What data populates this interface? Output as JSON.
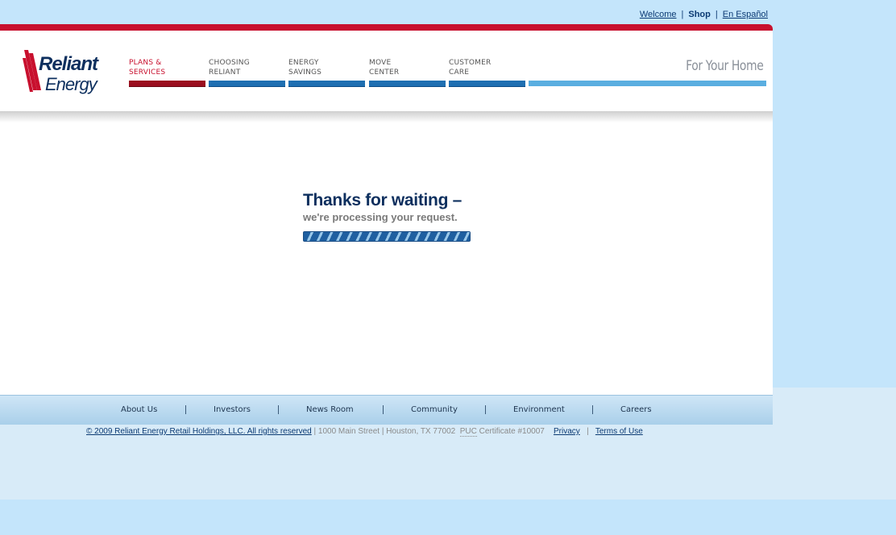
{
  "util": {
    "welcome": "Welcome",
    "shop": "Shop",
    "espanol": "En Español"
  },
  "brand": {
    "logo_line1": "Reliant",
    "logo_line2": "Energy",
    "red": "#c8102e",
    "blue": "#1f6fb2"
  },
  "nav": [
    {
      "label": "PLANS &\nSERVICES",
      "active": true
    },
    {
      "label": "CHOOSING\nRELIANT",
      "active": false
    },
    {
      "label": "ENERGY\nSAVINGS",
      "active": false
    },
    {
      "label": "MOVE\nCENTER",
      "active": false
    },
    {
      "label": "CUSTOMER\nCARE",
      "active": false
    }
  ],
  "tagline": "For Your Home",
  "wait": {
    "title": "Thanks for waiting –",
    "subtitle": "we're processing your request."
  },
  "footer_nav": [
    "About Us",
    "Investors",
    "News Room",
    "Community",
    "Environment",
    "Careers"
  ],
  "legal": {
    "copyright": "© 2009 Reliant Energy Retail Holdings, LLC. All rights reserved",
    "address": "| 1000 Main Street | Houston, TX 77002",
    "puc": "PUC",
    "certificate": "Certificate #10007",
    "privacy": "Privacy",
    "sep": "|",
    "terms": "Terms of Use"
  }
}
